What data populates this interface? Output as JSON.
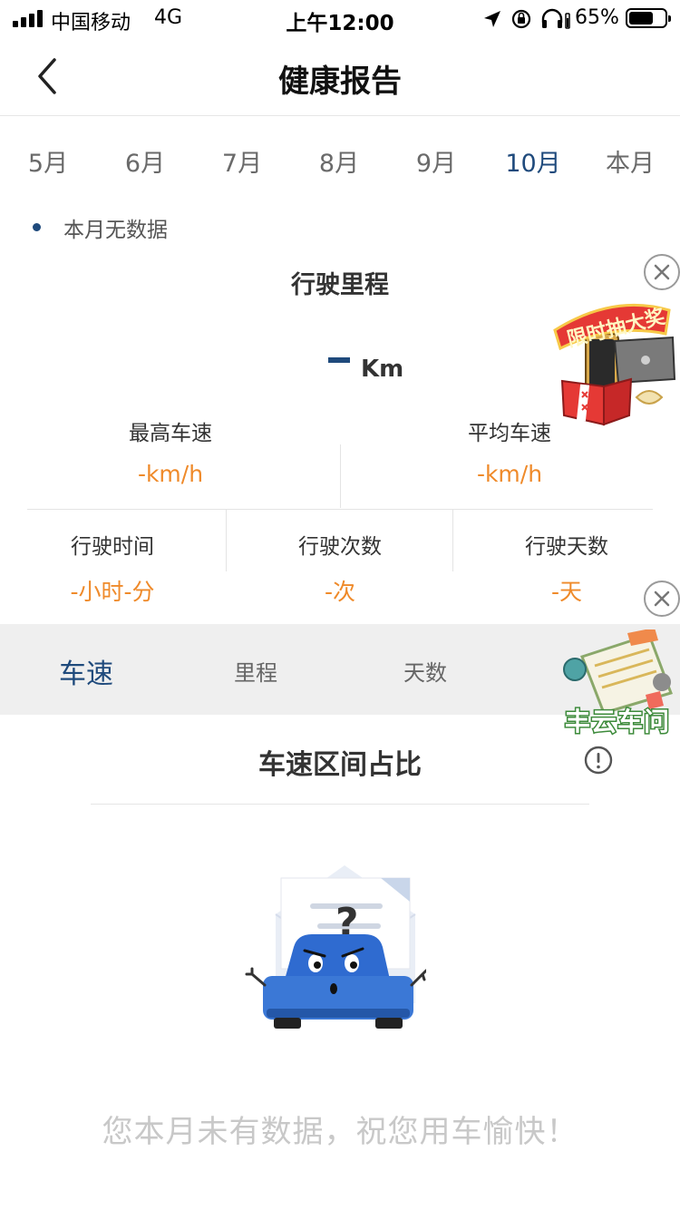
{
  "status_bar": {
    "carrier": "中国移动",
    "network": "4G",
    "time": "上午12:00",
    "battery_percent": "65%",
    "battery_level": 0.65
  },
  "nav": {
    "title": "健康报告",
    "back_icon": "chevron-left-icon"
  },
  "months": {
    "items": [
      "5月",
      "6月",
      "7月",
      "8月",
      "9月",
      "10月",
      "本月"
    ],
    "selected": "10月",
    "accent": "#1f4a7c"
  },
  "summary": {
    "no_data_note": "本月无数据",
    "section_title": "行驶里程",
    "mileage_unit": "Km",
    "max_speed_label": "最高车速",
    "max_speed_value": "-km/h",
    "avg_speed_label": "平均车速",
    "avg_speed_value": "-km/h",
    "drive_time_label": "行驶时间",
    "drive_time_value": "-小时-分",
    "drive_count_label": "行驶次数",
    "drive_count_value": "-次",
    "drive_days_label": "行驶天数",
    "drive_days_value": "-天",
    "value_color": "#ef8a2a"
  },
  "promos": {
    "lottery_text": "限时抽大奖",
    "assistant_text": "丰云车问"
  },
  "sub_tabs": {
    "items": [
      "车速",
      "里程",
      "天数"
    ],
    "selected": "车速"
  },
  "chart": {
    "title": "车速区间占比",
    "empty_message": "您本月未有数据，祝您用车愉快！"
  }
}
